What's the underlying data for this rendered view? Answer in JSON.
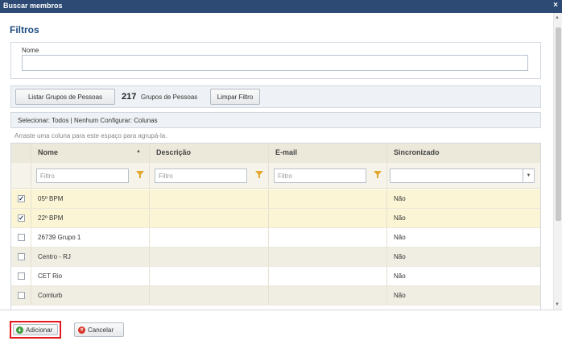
{
  "dialog": {
    "title": "Buscar membros",
    "close_glyph": "×"
  },
  "filters": {
    "heading": "Filtros",
    "name_label": "Nome",
    "name_value": ""
  },
  "toolbar": {
    "list_button": "Listar Grupos de Pessoas",
    "count": "217",
    "count_label": "Grupos de Pessoas",
    "clear_button": "Limpar Filtro"
  },
  "selection_bar": {
    "text": "Selecionar: Todos | Nenhum   Configurar: Colunas"
  },
  "group_hint": "Arraste uma coluna para este espaço para agrupá-la.",
  "grid": {
    "columns": [
      "Nome",
      "Descrição",
      "E-mail",
      "Sincronizado"
    ],
    "filter_placeholder": "Filtro",
    "sync_filter_value": "",
    "rows": [
      {
        "name": "05º BPM",
        "description": "",
        "email": "",
        "sync": "Não",
        "checked": true
      },
      {
        "name": "22º BPM",
        "description": "",
        "email": "",
        "sync": "Não",
        "checked": true
      },
      {
        "name": "26739 Grupo 1",
        "description": "",
        "email": "",
        "sync": "Não",
        "checked": false
      },
      {
        "name": "Centro - RJ",
        "description": "",
        "email": "",
        "sync": "Não",
        "checked": false
      },
      {
        "name": "CET Rio",
        "description": "",
        "email": "",
        "sync": "Não",
        "checked": false
      },
      {
        "name": "Comlurb",
        "description": "",
        "email": "",
        "sync": "Não",
        "checked": false
      }
    ]
  },
  "footer": {
    "add_button": "Adicionar",
    "cancel_button": "Cancelar"
  },
  "icons": {
    "add": "plus-circle-icon",
    "cancel": "x-circle-icon",
    "filter": "funnel-icon",
    "sort": "sort-asc-icon"
  },
  "colors": {
    "titlebar": "#2c4a73",
    "heading": "#1d4b80",
    "selected_row": "#fbf5d6",
    "highlight_border": "#e5171f"
  }
}
